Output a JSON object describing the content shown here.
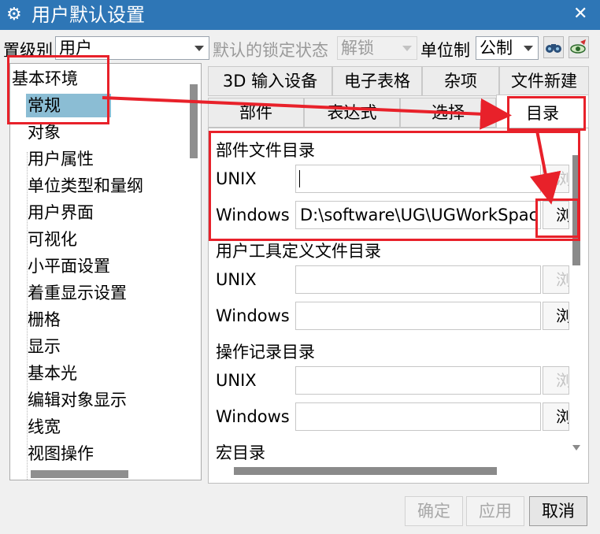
{
  "window": {
    "title": "用户默认设置",
    "close_label": "✕"
  },
  "toolbar": {
    "level_label": "置级别",
    "level_value": "用户",
    "lock_label": "默认的锁定状态",
    "lock_value": "解锁",
    "unit_label": "单位制",
    "unit_value": "公制"
  },
  "tree": {
    "root": "基本环境",
    "items": [
      "常规",
      "对象",
      "用户属性",
      "单位类型和量纲",
      "用户界面",
      "可视化",
      "小平面设置",
      "着重显示设置",
      "栅格",
      "显示",
      "基本光",
      "编辑对象显示",
      "线宽",
      "视图操作"
    ],
    "selected": "常规"
  },
  "tabs": {
    "row1": [
      "3D 输入设备",
      "电子表格",
      "杂项",
      "文件新建"
    ],
    "row2": [
      "部件",
      "表达式",
      "选择",
      "目录"
    ],
    "active": "目录"
  },
  "panel": {
    "groups": [
      {
        "title": "部件文件目录",
        "unix_label": "UNIX",
        "unix_value": "",
        "windows_label": "Windows",
        "windows_value": "D:\\software\\UG\\UGWorkSpace"
      },
      {
        "title": "用户工具定义文件目录",
        "unix_label": "UNIX",
        "unix_value": "",
        "windows_label": "Windows",
        "windows_value": ""
      },
      {
        "title": "操作记录目录",
        "unix_label": "UNIX",
        "unix_value": "",
        "windows_label": "Windows",
        "windows_value": ""
      },
      {
        "title": "宏目录"
      }
    ],
    "browse_glyph": "浏"
  },
  "buttons": {
    "ok": "确定",
    "apply": "应用",
    "cancel": "取消"
  },
  "colors": {
    "titlebar": "#2e76b6",
    "selection": "#8bbdd4",
    "annotation": "#e8212a"
  }
}
